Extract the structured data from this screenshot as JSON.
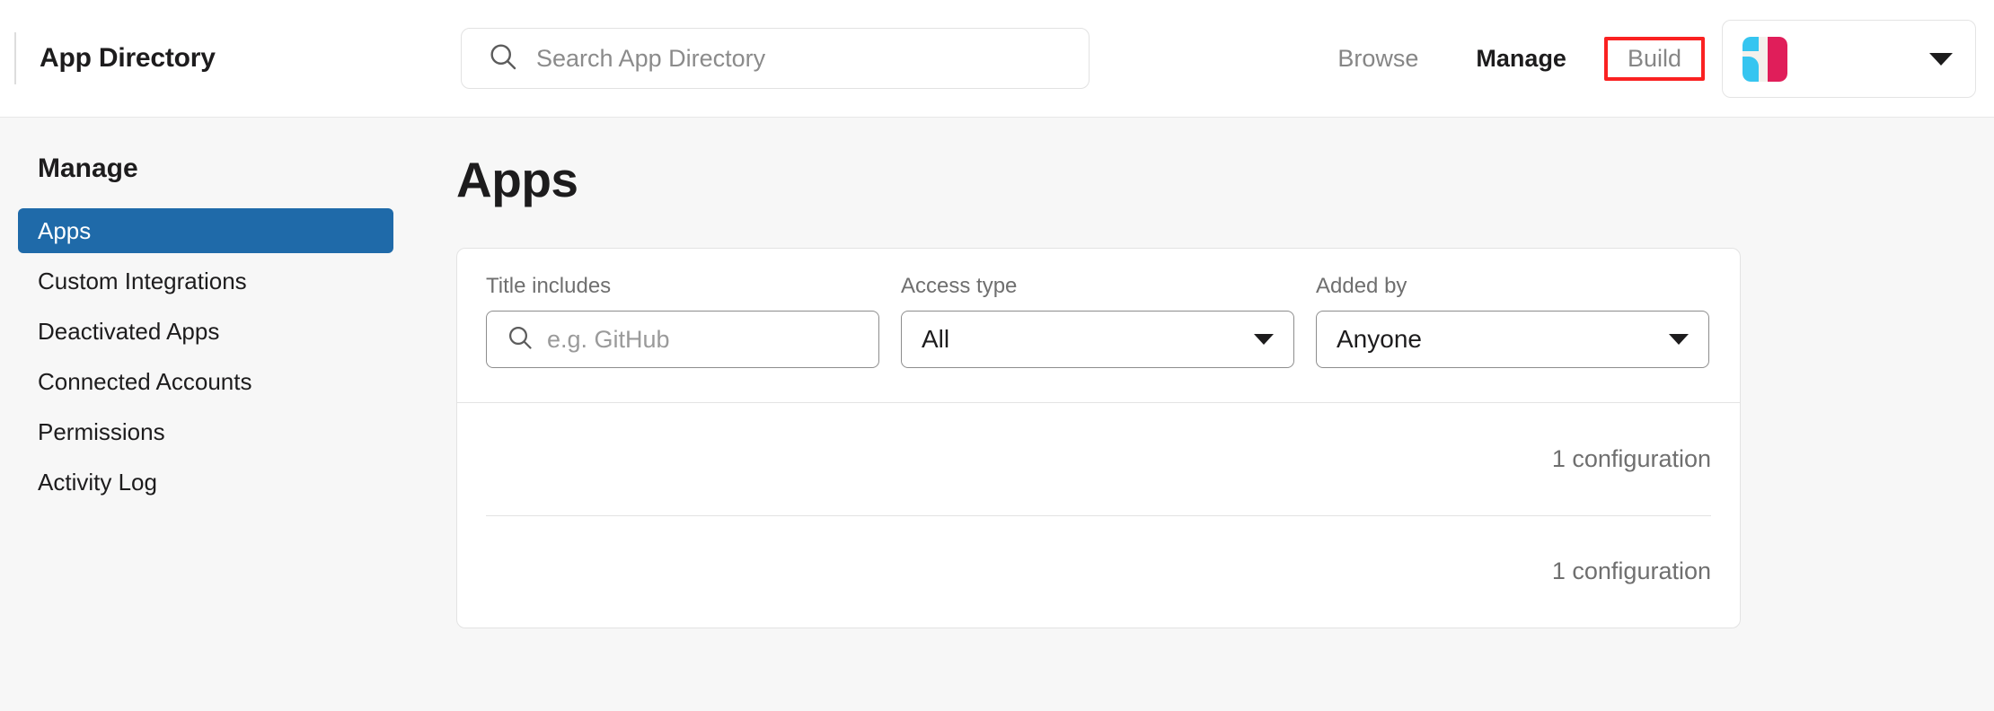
{
  "header": {
    "brand_title": "App Directory",
    "search": {
      "placeholder": "Search App Directory",
      "value": ""
    },
    "nav": [
      {
        "label": "Browse",
        "state": "default"
      },
      {
        "label": "Manage",
        "state": "active"
      },
      {
        "label": "Build",
        "state": "highlighted"
      }
    ],
    "highlight_color": "#fa2121",
    "workspace": {
      "logo_colors": {
        "cyan": "#36c5f0",
        "crimson": "#e01e5a",
        "cream": "#f4ede4"
      }
    }
  },
  "sidebar": {
    "heading": "Manage",
    "selected_color": "#1f6aa9",
    "items": [
      {
        "label": "Apps",
        "selected": true
      },
      {
        "label": "Custom Integrations",
        "selected": false
      },
      {
        "label": "Deactivated Apps",
        "selected": false
      },
      {
        "label": "Connected Accounts",
        "selected": false
      },
      {
        "label": "Permissions",
        "selected": false
      },
      {
        "label": "Activity Log",
        "selected": false
      }
    ]
  },
  "main": {
    "title": "Apps",
    "filters": {
      "title_includes": {
        "label": "Title includes",
        "placeholder": "e.g. GitHub",
        "value": ""
      },
      "access_type": {
        "label": "Access type",
        "value": "All"
      },
      "added_by": {
        "label": "Added by",
        "value": "Anyone"
      }
    },
    "rows": [
      {
        "meta": "1 configuration"
      },
      {
        "meta": "1 configuration"
      }
    ]
  }
}
